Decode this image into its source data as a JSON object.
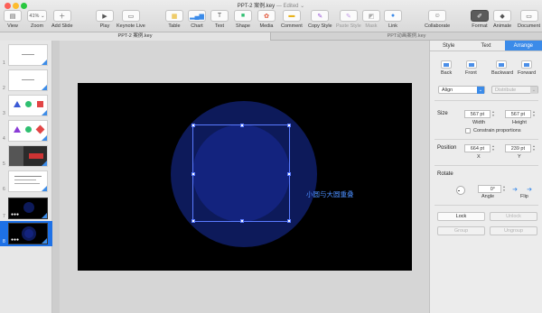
{
  "window": {
    "title": "PPT-2 案例.key",
    "edited": "— Edited ⌄"
  },
  "toolbar": {
    "view": {
      "label": "View",
      "icon": "view-menu-icon"
    },
    "zoom": {
      "label": "Zoom",
      "value": "41% ⌄"
    },
    "add_slide": {
      "label": "Add Slide",
      "icon": "plus-icon"
    },
    "play": {
      "label": "Play",
      "icon": "play-icon"
    },
    "keynote_live": {
      "label": "Keynote Live",
      "icon": "broadcast-icon"
    },
    "table": {
      "label": "Table",
      "icon": "table-icon"
    },
    "chart": {
      "label": "Chart",
      "icon": "chart-icon"
    },
    "text": {
      "label": "Text",
      "icon": "text-box-icon"
    },
    "shape": {
      "label": "Shape",
      "icon": "shape-icon"
    },
    "media": {
      "label": "Media",
      "icon": "media-icon"
    },
    "comment": {
      "label": "Comment",
      "icon": "comment-icon"
    },
    "copy_style": {
      "label": "Copy Style",
      "icon": "brush-icon"
    },
    "paste_style": {
      "label": "Paste Style",
      "icon": "paste-brush-icon"
    },
    "mask": {
      "label": "Mask",
      "icon": "mask-icon"
    },
    "link": {
      "label": "Link",
      "icon": "link-icon"
    },
    "collaborate": {
      "label": "Collaborate",
      "icon": "person-plus-icon"
    },
    "format": {
      "label": "Format",
      "icon": "paintbrush-icon"
    },
    "animate": {
      "label": "Animate",
      "icon": "diamond-icon"
    },
    "document": {
      "label": "Document",
      "icon": "document-icon"
    }
  },
  "tabs": [
    {
      "label": "PPT-2 案例.key"
    },
    {
      "label": "PPT动画案例.key"
    }
  ],
  "navigator": {
    "slides": [
      {
        "num": "1"
      },
      {
        "num": "2"
      },
      {
        "num": "3"
      },
      {
        "num": "4"
      },
      {
        "num": "5"
      },
      {
        "num": "6"
      },
      {
        "num": "7"
      },
      {
        "num": "8"
      }
    ],
    "selected_index": 8
  },
  "slide": {
    "text": "小圆与大圆重叠",
    "colors": {
      "background": "#000000",
      "big_circle": "#0d1a5a",
      "small_circle": "#13237e",
      "text": "#4c8fff"
    }
  },
  "inspector": {
    "tabs": [
      {
        "label": "Style"
      },
      {
        "label": "Text"
      },
      {
        "label": "Arrange"
      }
    ],
    "active_tab": "Arrange",
    "back_label": "Back",
    "front_label": "Front",
    "backward_label": "Backward",
    "forward_label": "Forward",
    "align_label": "Align",
    "distribute_label": "Distribute",
    "size_label": "Size",
    "width_value": "567 pt",
    "height_value": "567 pt",
    "width_label": "Width",
    "height_label": "Height",
    "constrain_label": "Constrain proportions",
    "position_label": "Position",
    "x_value": "664 pt",
    "y_value": "239 pt",
    "x_label": "X",
    "y_label": "Y",
    "rotate_label": "Rotate",
    "angle_value": "0°",
    "angle_label": "Angle",
    "flip_label": "Flip",
    "lock_label": "Lock",
    "unlock_label": "Unlock",
    "group_label": "Group",
    "ungroup_label": "Ungroup"
  }
}
